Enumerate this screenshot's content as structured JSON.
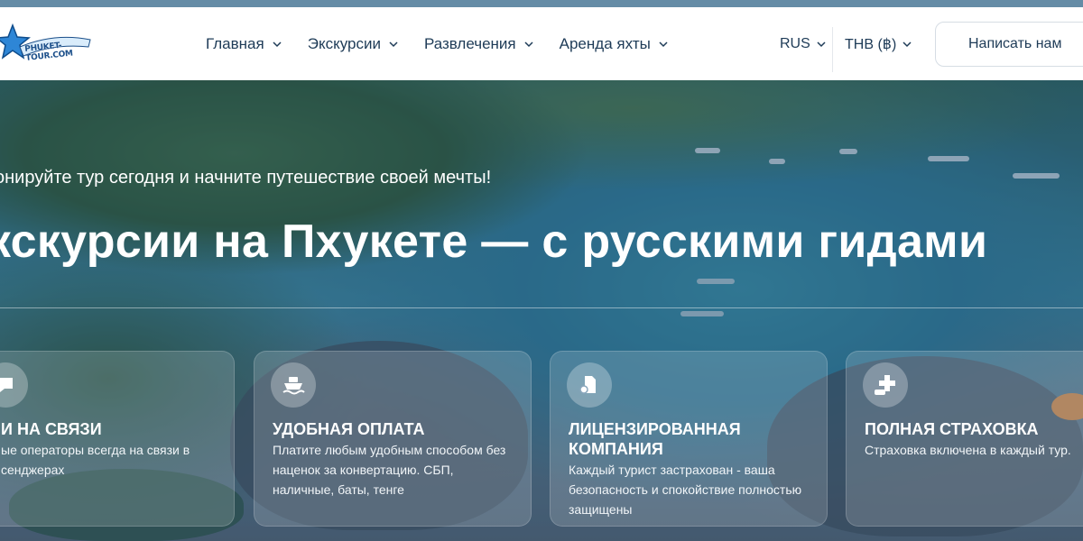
{
  "header": {
    "logo_text": "PHUKET-TOUR.COM",
    "nav": [
      {
        "label": "Главная"
      },
      {
        "label": "Экскурсии"
      },
      {
        "label": "Развлечения"
      },
      {
        "label": "Аренда яхты"
      }
    ],
    "language": "RUS",
    "currency": "THB (฿)",
    "contact_button": "Написать нам"
  },
  "hero": {
    "tagline": "онируйте тур сегодня и начните путешествие своей мечты!",
    "title": "кскурсии на Пхукете — с русскими гидами"
  },
  "features": [
    {
      "title": "И НА СВЯЗИ",
      "text": "ые операторы всегда на связи в сенджерах",
      "icon": "chat-icon"
    },
    {
      "title": "УДОБНАЯ ОПЛАТА",
      "text": "Платите любым удобным способом без наценок за конвертацию. СБП, наличные, баты, тенге",
      "icon": "ship-icon"
    },
    {
      "title": "ЛИЦЕНЗИРОВАННАЯ КОМПАНИЯ",
      "text": "Каждый турист застрахован - ваша безопасность и спокойствие полностью защищены",
      "icon": "license-icon"
    },
    {
      "title": "ПОЛНАЯ СТРАХОВКА",
      "text": "Страховка включена в каждый тур.",
      "icon": "medical-insurance-icon"
    }
  ],
  "colors": {
    "text_dark": "#1e3b57",
    "white": "#ffffff"
  }
}
